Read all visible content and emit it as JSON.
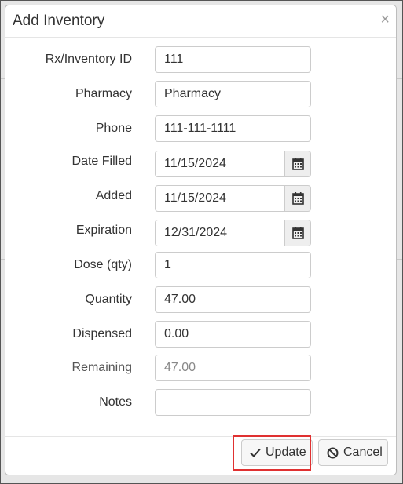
{
  "dialog": {
    "title": "Add Inventory",
    "close_glyph": "×"
  },
  "fields": [
    {
      "label": "Rx/Inventory ID",
      "value": "111",
      "type": "text"
    },
    {
      "label": "Pharmacy",
      "value": "Pharmacy",
      "type": "text"
    },
    {
      "label": "Phone",
      "value": "111-111-1111",
      "type": "text"
    },
    {
      "label": "Date Filled",
      "value": "11/15/2024",
      "type": "date",
      "icon": "calendar-icon"
    },
    {
      "label": "Added",
      "value": "11/15/2024",
      "type": "date",
      "icon": "calendar-icon"
    },
    {
      "label": "Expiration",
      "value": "12/31/2024",
      "type": "date",
      "icon": "calendar-icon"
    },
    {
      "label": "Dose (qty)",
      "value": "1",
      "type": "text"
    },
    {
      "label": "Quantity",
      "value": "47.00",
      "type": "text"
    },
    {
      "label": "Dispensed",
      "value": "0.00",
      "type": "text"
    },
    {
      "label": "Remaining",
      "value": "47.00",
      "type": "readonly"
    },
    {
      "label": "Notes",
      "value": "",
      "type": "text"
    }
  ],
  "footer": {
    "update_label": "Update",
    "update_icon": "check-icon",
    "cancel_label": "Cancel",
    "cancel_icon": "ban-icon"
  },
  "colors": {
    "highlight": "#e03131"
  }
}
